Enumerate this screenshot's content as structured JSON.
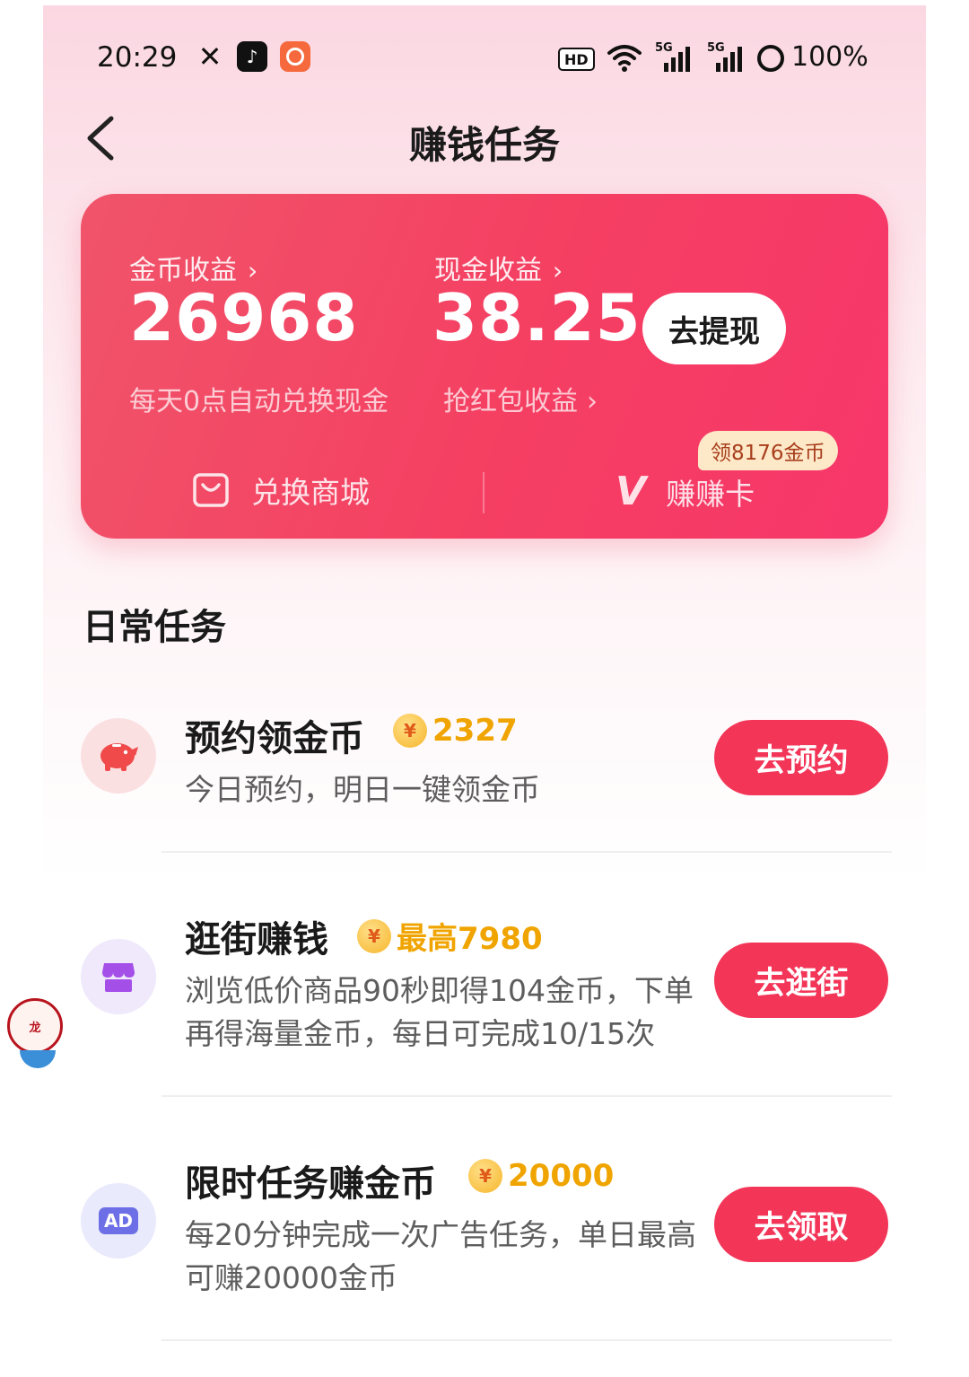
{
  "status_bar": {
    "time": "20:29",
    "hd_label": "HD",
    "network_label": "5G",
    "battery": "100%"
  },
  "header": {
    "title": "赚钱任务"
  },
  "earnings_card": {
    "coin_label": "金币收益",
    "coin_value": "26968",
    "coin_note": "每天0点自动兑换现金",
    "cash_label": "现金收益",
    "cash_value": "38.25",
    "withdraw_label": "去提现",
    "red_packet_label": "抢红包收益",
    "mall_label": "兑换商城",
    "earn_card_label": "赚赚卡",
    "promo_badge": "领8176金币",
    "chevron": "›"
  },
  "daily": {
    "title": "日常任务",
    "tasks": [
      {
        "title": "预约领金币",
        "reward": "2327",
        "desc": "今日预约，明日一键领金币",
        "button": "去预约",
        "icon": "piggy-bank-icon",
        "icon_bg": "#fbe0e2",
        "icon_color": "#f04a4a"
      },
      {
        "title": "逛街赚钱",
        "reward": "最高7980",
        "desc": "浏览低价商品90秒即得104金币，下单再得海量金币，每日可完成10/15次",
        "button": "去逛街",
        "icon": "shop-icon",
        "icon_bg": "#efe9fb",
        "icon_color": "#a34fe8"
      },
      {
        "title": "限时任务赚金币",
        "reward": "20000",
        "desc": "每20分钟完成一次广告任务，单日最高可赚20000金币",
        "button": "去领取",
        "icon": "ad-icon",
        "icon_label": "AD",
        "icon_bg": "#e9eafb",
        "icon_color": "#6d6fe6"
      }
    ]
  },
  "coin_symbol": "¥",
  "colors": {
    "accent": "#f33558",
    "card_start": "#f0546a",
    "reward": "#f0a400"
  }
}
